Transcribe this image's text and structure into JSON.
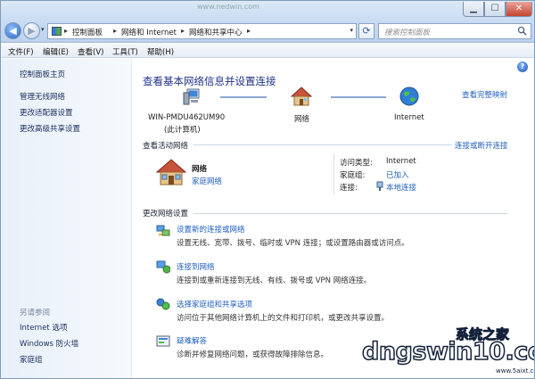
{
  "window": {
    "title_faint": "www.nedwin.com",
    "minimize": "▁",
    "maximize": "☐",
    "close": "✕"
  },
  "address_bar": {
    "breadcrumbs": [
      "控制面板",
      "网络和 Internet",
      "网络和共享中心"
    ],
    "separators": [
      "▸",
      "▸",
      "▸",
      "▸"
    ],
    "dropdown": "▾"
  },
  "search": {
    "placeholder": "搜索控制面板"
  },
  "menu": [
    {
      "label": "文件(F)"
    },
    {
      "label": "编辑(E)"
    },
    {
      "label": "查看(V)"
    },
    {
      "label": "工具(T)"
    },
    {
      "label": "帮助(H)"
    }
  ],
  "left_pane": {
    "links": [
      "控制面板主页",
      "管理无线网络",
      "更改适配器设置",
      "更改高级共享设置"
    ],
    "see_also_title": "另请参阅",
    "see_also": [
      "Internet 选项",
      "Windows 防火墙",
      "家庭组"
    ]
  },
  "main": {
    "help_icon": "?",
    "heading": "查看基本网络信息并设置连接",
    "full_map_link": "查看完整映射",
    "map": {
      "computer_name": "WIN-PMDU462UM90",
      "computer_sub": "(此计算机)",
      "network_label": "网络",
      "internet_label": "Internet"
    },
    "active_networks": {
      "title": "查看活动网络",
      "connect_link": "连接或断开连接",
      "network_name": "网络",
      "network_type": "家庭网络",
      "access_type_label": "访问类型:",
      "access_type_value": "Internet",
      "homegroup_label": "家庭组:",
      "homegroup_value": "已加入",
      "connection_label": "连接:",
      "connection_value": "本地连接"
    },
    "change_settings": {
      "title": "更改网络设置",
      "tasks": [
        {
          "title": "设置新的连接或网络",
          "desc": "设置无线、宽带、拨号、临时或 VPN 连接；或设置路由器或访问点。"
        },
        {
          "title": "连接到网络",
          "desc": "连接到或重新连接到无线、有线、拨号或 VPN 网络连接。"
        },
        {
          "title": "选择家庭组和共享选项",
          "desc": "访问位于其他网络计算机上的文件和打印机，或更改共享设置。"
        },
        {
          "title": "疑难解答",
          "desc": "诊断并修复网络问题，或获得故障排除信息。"
        }
      ]
    }
  },
  "watermark": {
    "brand": "dngswin10.com",
    "cn": "系统之家",
    "small": "www.5aixt.com"
  }
}
